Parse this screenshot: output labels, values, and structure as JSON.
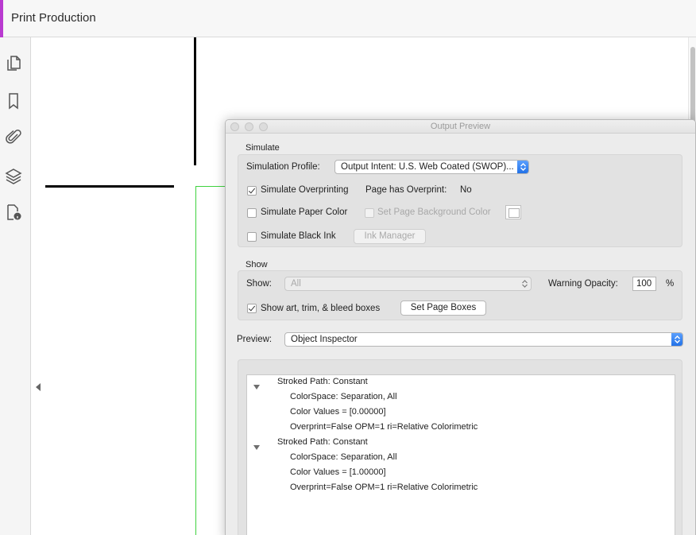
{
  "app": {
    "title": "Print Production",
    "accent_color": "#b93ad0"
  },
  "left_toolbar": {
    "icons": [
      "pages-icon",
      "bookmark-icon",
      "attachment-icon",
      "layers-icon",
      "document-properties-icon"
    ]
  },
  "dialog": {
    "title": "Output Preview",
    "simulate": {
      "section_label": "Simulate",
      "profile_label": "Simulation Profile:",
      "profile_value": "Output Intent: U.S. Web Coated (SWOP)...",
      "overprint_label": "Simulate Overprinting",
      "overprint_checked": true,
      "page_overprint_label": "Page has Overprint:",
      "page_overprint_value": "No",
      "paper_color_label": "Simulate Paper Color",
      "paper_color_checked": false,
      "bg_color_label": "Set Page Background Color",
      "black_ink_label": "Simulate Black Ink",
      "black_ink_checked": false,
      "ink_manager_label": "Ink Manager"
    },
    "show": {
      "section_label": "Show",
      "show_label": "Show:",
      "show_value": "All",
      "warning_opacity_label": "Warning Opacity:",
      "warning_opacity_value": "100",
      "percent": "%",
      "boxes_label": "Show art, trim, & bleed boxes",
      "boxes_checked": true,
      "set_boxes_label": "Set Page Boxes"
    },
    "preview": {
      "label": "Preview:",
      "value": "Object Inspector"
    },
    "inspector": {
      "nodes": [
        {
          "title": "Stroked Path: Constant",
          "children": [
            "ColorSpace: Separation, All",
            "Color Values = [0.00000]",
            "Overprint=False OPM=1 ri=Relative Colorimetric"
          ]
        },
        {
          "title": "Stroked Path: Constant",
          "children": [
            "ColorSpace: Separation, All",
            "Color Values = [1.00000]",
            "Overprint=False OPM=1 ri=Relative Colorimetric"
          ]
        }
      ]
    }
  }
}
